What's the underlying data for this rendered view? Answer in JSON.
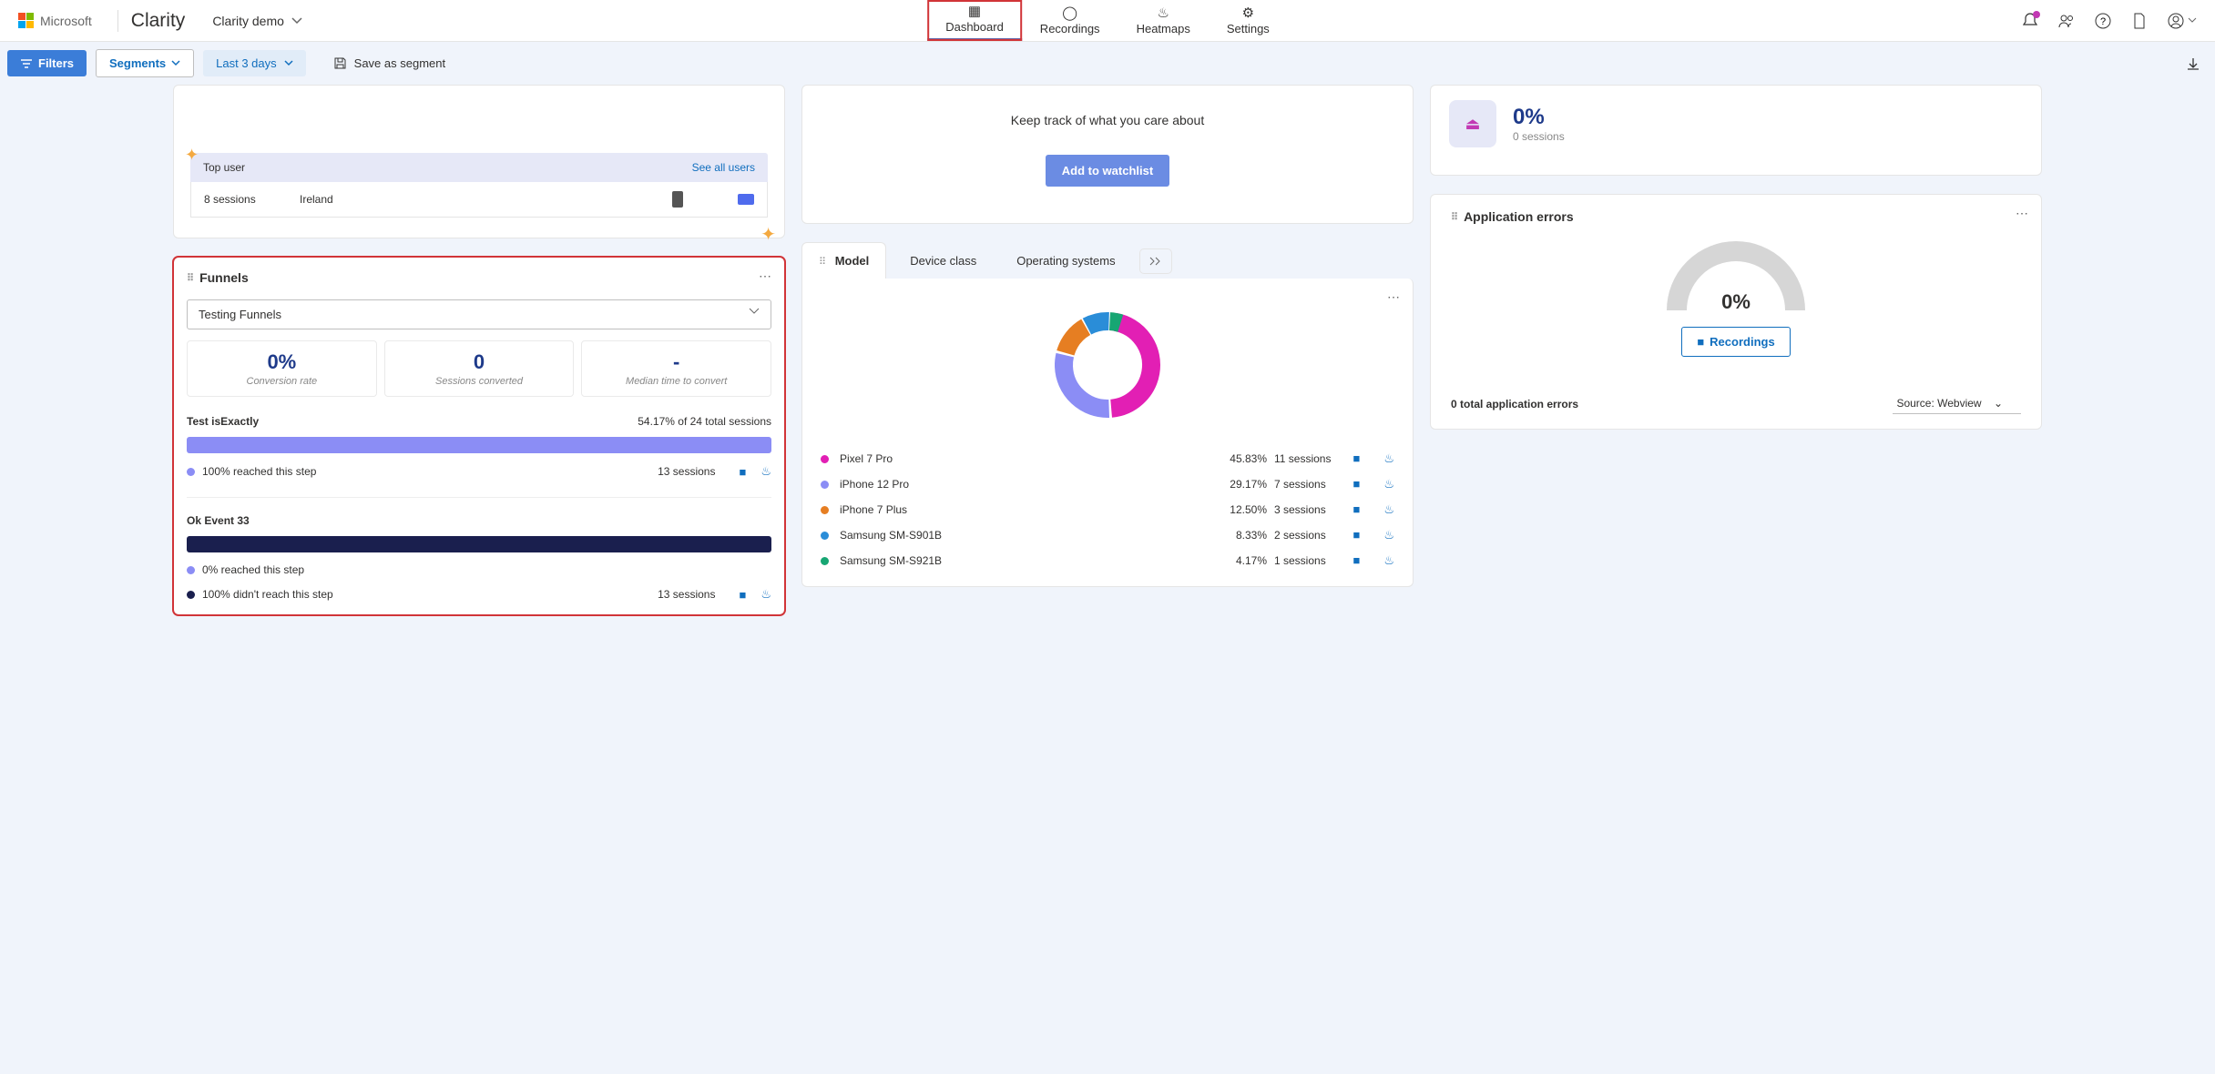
{
  "header": {
    "ms": "Microsoft",
    "app": "Clarity",
    "project": "Clarity demo",
    "nav": {
      "dashboard": "Dashboard",
      "recordings": "Recordings",
      "heatmaps": "Heatmaps",
      "settings": "Settings"
    }
  },
  "filterbar": {
    "filters": "Filters",
    "segments": "Segments",
    "daterange": "Last 3 days",
    "save": "Save as segment"
  },
  "topuser": {
    "title": "Top user",
    "link": "See all users",
    "sessions": "8 sessions",
    "country": "Ireland"
  },
  "watchlist": {
    "text": "Keep track of what you care about",
    "btn": "Add to watchlist"
  },
  "pctcard": {
    "value": "0%",
    "sub": "0 sessions"
  },
  "funnels": {
    "title": "Funnels",
    "select": "Testing Funnels",
    "stats": [
      {
        "val": "0%",
        "lbl": "Conversion rate"
      },
      {
        "val": "0",
        "lbl": "Sessions converted"
      },
      {
        "val": "-",
        "lbl": "Median time to convert"
      }
    ],
    "steps": [
      {
        "name": "Test isExactly",
        "right": "54.17% of 24 total sessions",
        "rows": [
          {
            "dot": "purple",
            "text": "100% reached this step",
            "sess": "13 sessions"
          }
        ]
      },
      {
        "name": "Ok Event 33",
        "right": "",
        "rows": [
          {
            "dot": "purple",
            "text": "0% reached this step",
            "sess": ""
          },
          {
            "dot": "dark",
            "text": "100% didn't reach this step",
            "sess": "13 sessions"
          }
        ]
      }
    ]
  },
  "model": {
    "tabs": {
      "model": "Model",
      "device": "Device class",
      "os": "Operating systems"
    },
    "rows": [
      {
        "color": "#e21fb4",
        "name": "Pixel 7 Pro",
        "pct": "45.83%",
        "sess": "11 sessions"
      },
      {
        "color": "#8b8df5",
        "name": "iPhone 12 Pro",
        "pct": "29.17%",
        "sess": "7 sessions"
      },
      {
        "color": "#e67e22",
        "name": "iPhone 7 Plus",
        "pct": "12.50%",
        "sess": "3 sessions"
      },
      {
        "color": "#2a8dd8",
        "name": "Samsung SM-S901B",
        "pct": "8.33%",
        "sess": "2 sessions"
      },
      {
        "color": "#17a673",
        "name": "Samsung SM-S921B",
        "pct": "4.17%",
        "sess": "1 sessions"
      }
    ]
  },
  "apperrors": {
    "title": "Application errors",
    "pct": "0%",
    "btn": "Recordings",
    "total": "0 total application errors",
    "source": "Source: Webview"
  },
  "chart_data": {
    "type": "pie",
    "title": "Model",
    "series": [
      {
        "name": "Pixel 7 Pro",
        "value": 45.83,
        "sessions": 11
      },
      {
        "name": "iPhone 12 Pro",
        "value": 29.17,
        "sessions": 7
      },
      {
        "name": "iPhone 7 Plus",
        "value": 12.5,
        "sessions": 3
      },
      {
        "name": "Samsung SM-S901B",
        "value": 8.33,
        "sessions": 2
      },
      {
        "name": "Samsung SM-S921B",
        "value": 4.17,
        "sessions": 1
      }
    ]
  }
}
